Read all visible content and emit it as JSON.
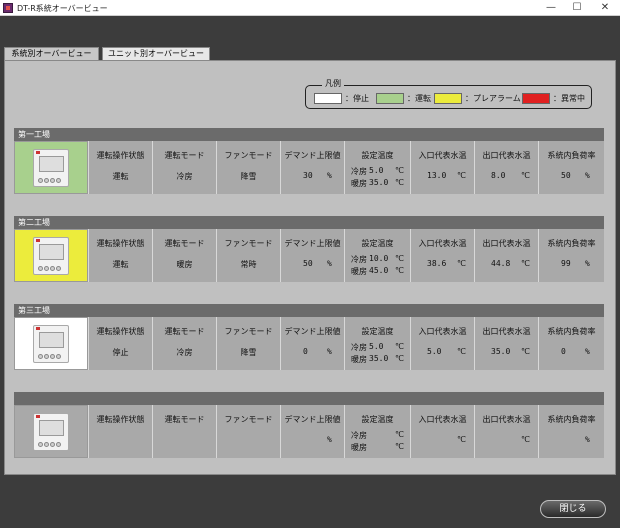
{
  "window": {
    "title": "DT-R系統オーバービュー",
    "minimize": "—",
    "maximize": "☐",
    "close": "✕"
  },
  "tabs": [
    {
      "label": "系統別オーバービュー",
      "active": false
    },
    {
      "label": "ユニット別オーバービュー",
      "active": true
    }
  ],
  "legend": {
    "title": "凡例",
    "items": [
      {
        "label": "：停止",
        "color": "#ffffff"
      },
      {
        "label": "：運転",
        "color": "#a8d08d"
      },
      {
        "label": "：プレアラーム",
        "color": "#ecec3c"
      },
      {
        "label": "：異常中",
        "color": "#e02020"
      }
    ]
  },
  "columns": [
    "運転操作状態",
    "運転モード",
    "ファンモード",
    "デマンド上限値",
    "設定温度",
    "入口代表水温",
    "出口代表水温",
    "系統内負荷率"
  ],
  "labels": {
    "cool": "冷房",
    "heat": "暖房",
    "deg": "℃",
    "pct": "%"
  },
  "groups": [
    {
      "name": "第一工場",
      "status_color": "#a8d08d",
      "operation": "運転",
      "mode": "冷房",
      "fan": "降雪",
      "demand": "30",
      "cool_temp": "5.0",
      "heat_temp": "35.0",
      "inlet": "13.0",
      "outlet": "8.0",
      "load": "50"
    },
    {
      "name": "第二工場",
      "status_color": "#ecec3c",
      "operation": "運転",
      "mode": "暖房",
      "fan": "常時",
      "demand": "50",
      "cool_temp": "10.0",
      "heat_temp": "45.0",
      "inlet": "38.6",
      "outlet": "44.8",
      "load": "99"
    },
    {
      "name": "第三工場",
      "status_color": "#ffffff",
      "operation": "停止",
      "mode": "冷房",
      "fan": "降雪",
      "demand": "0",
      "cool_temp": "5.0",
      "heat_temp": "35.0",
      "inlet": "5.0",
      "outlet": "35.0",
      "load": "0"
    },
    {
      "name": "",
      "status_color": "#a9a9a9",
      "operation": "",
      "mode": "",
      "fan": "",
      "demand": "",
      "cool_temp": "",
      "heat_temp": "",
      "inlet": "",
      "outlet": "",
      "load": ""
    }
  ],
  "footer": {
    "close_label": "閉じる"
  }
}
